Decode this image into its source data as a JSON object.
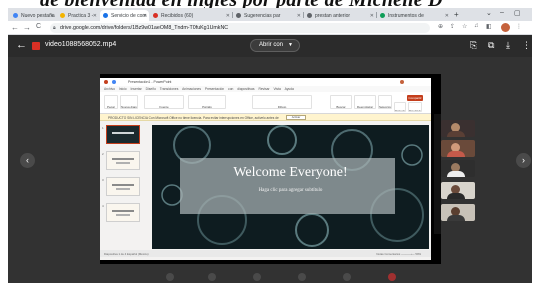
{
  "caption": "de bienvenida en ingles por parte de Michelle D",
  "browser": {
    "tabs": [
      {
        "label": "Nuevo pestaña",
        "color": "#4285f4"
      },
      {
        "label": "Practica 3 - ",
        "color": "#f4b400"
      },
      {
        "label": "Servicio de com",
        "color": "#1a73e8"
      },
      {
        "label": "Recibidos (60)",
        "color": "#d93025"
      },
      {
        "label": "Sugerencias par",
        "color": "#5f6368"
      },
      {
        "label": "prestan anterior",
        "color": "#5f6368"
      },
      {
        "label": "Instrumentos de",
        "color": "#0f9d58"
      }
    ],
    "new_tab": "+",
    "url": "drive.google.com/drive/folders/1Bz9w01aeOM8_Tndm-T0fuKg1UmkNC",
    "nav": {
      "back": "←",
      "forward": "→",
      "reload": "C"
    }
  },
  "viewer": {
    "filename": "video1088568052.mp4",
    "open_with": "Abrir con",
    "icons": {
      "back": "arrow-left-icon",
      "file": "video-file-icon",
      "add_shortcut": "add-to-drive-icon",
      "open_new": "open-in-new-window-icon",
      "download": "download-icon",
      "more": "more-vert-icon"
    }
  },
  "ppt": {
    "title_bar": "Presentación1 - PowerPoint",
    "menu_tabs": [
      "Archivo",
      "Inicio",
      "Insertar",
      "Diseño",
      "Transiciones",
      "Animaciones",
      "Presentación con diapositivas",
      "Revisar",
      "Vista",
      "Ayuda"
    ],
    "ribbon_buttons": [
      "Pegar",
      "Nueva diapositiva",
      "Fuente",
      "Párrafo",
      "Dibujo",
      "Buscar",
      "Reemplazar",
      "Seleccionar",
      "Dictado",
      "Diseñador"
    ],
    "share_label": "Compartir",
    "banner_text": "PRODUCTO SIN LICENCIA  Con Microsoft Office no tiene licencia. Para evitar interrupciones en Office, actívelo antes de",
    "banner_button": "Activar",
    "slide_title": "Welcome Everyone!",
    "slide_subtitle": "Haga clic para agregar subtítulo",
    "slide_numbers": [
      "1",
      "2",
      "3",
      "4"
    ],
    "status_left": "Diapositiva 1 de 4   Español (México)",
    "status_right": "Notas   Comentarios   ─────+─  59%"
  },
  "colors": {
    "viewer_bg": "#323232",
    "ppt_accent": "#c43e1c",
    "slide_bg": "#0e1c20",
    "drive_red": "#d93025"
  }
}
